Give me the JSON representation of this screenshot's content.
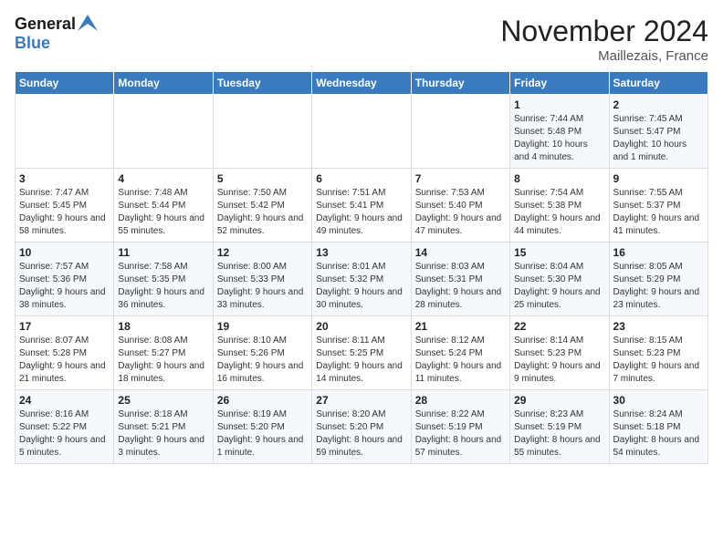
{
  "header": {
    "logo_line1": "General",
    "logo_line2": "Blue",
    "month_title": "November 2024",
    "location": "Maillezais, France"
  },
  "days_of_week": [
    "Sunday",
    "Monday",
    "Tuesday",
    "Wednesday",
    "Thursday",
    "Friday",
    "Saturday"
  ],
  "weeks": [
    [
      {
        "num": "",
        "info": ""
      },
      {
        "num": "",
        "info": ""
      },
      {
        "num": "",
        "info": ""
      },
      {
        "num": "",
        "info": ""
      },
      {
        "num": "",
        "info": ""
      },
      {
        "num": "1",
        "info": "Sunrise: 7:44 AM\nSunset: 5:48 PM\nDaylight: 10 hours and 4 minutes."
      },
      {
        "num": "2",
        "info": "Sunrise: 7:45 AM\nSunset: 5:47 PM\nDaylight: 10 hours and 1 minute."
      }
    ],
    [
      {
        "num": "3",
        "info": "Sunrise: 7:47 AM\nSunset: 5:45 PM\nDaylight: 9 hours and 58 minutes."
      },
      {
        "num": "4",
        "info": "Sunrise: 7:48 AM\nSunset: 5:44 PM\nDaylight: 9 hours and 55 minutes."
      },
      {
        "num": "5",
        "info": "Sunrise: 7:50 AM\nSunset: 5:42 PM\nDaylight: 9 hours and 52 minutes."
      },
      {
        "num": "6",
        "info": "Sunrise: 7:51 AM\nSunset: 5:41 PM\nDaylight: 9 hours and 49 minutes."
      },
      {
        "num": "7",
        "info": "Sunrise: 7:53 AM\nSunset: 5:40 PM\nDaylight: 9 hours and 47 minutes."
      },
      {
        "num": "8",
        "info": "Sunrise: 7:54 AM\nSunset: 5:38 PM\nDaylight: 9 hours and 44 minutes."
      },
      {
        "num": "9",
        "info": "Sunrise: 7:55 AM\nSunset: 5:37 PM\nDaylight: 9 hours and 41 minutes."
      }
    ],
    [
      {
        "num": "10",
        "info": "Sunrise: 7:57 AM\nSunset: 5:36 PM\nDaylight: 9 hours and 38 minutes."
      },
      {
        "num": "11",
        "info": "Sunrise: 7:58 AM\nSunset: 5:35 PM\nDaylight: 9 hours and 36 minutes."
      },
      {
        "num": "12",
        "info": "Sunrise: 8:00 AM\nSunset: 5:33 PM\nDaylight: 9 hours and 33 minutes."
      },
      {
        "num": "13",
        "info": "Sunrise: 8:01 AM\nSunset: 5:32 PM\nDaylight: 9 hours and 30 minutes."
      },
      {
        "num": "14",
        "info": "Sunrise: 8:03 AM\nSunset: 5:31 PM\nDaylight: 9 hours and 28 minutes."
      },
      {
        "num": "15",
        "info": "Sunrise: 8:04 AM\nSunset: 5:30 PM\nDaylight: 9 hours and 25 minutes."
      },
      {
        "num": "16",
        "info": "Sunrise: 8:05 AM\nSunset: 5:29 PM\nDaylight: 9 hours and 23 minutes."
      }
    ],
    [
      {
        "num": "17",
        "info": "Sunrise: 8:07 AM\nSunset: 5:28 PM\nDaylight: 9 hours and 21 minutes."
      },
      {
        "num": "18",
        "info": "Sunrise: 8:08 AM\nSunset: 5:27 PM\nDaylight: 9 hours and 18 minutes."
      },
      {
        "num": "19",
        "info": "Sunrise: 8:10 AM\nSunset: 5:26 PM\nDaylight: 9 hours and 16 minutes."
      },
      {
        "num": "20",
        "info": "Sunrise: 8:11 AM\nSunset: 5:25 PM\nDaylight: 9 hours and 14 minutes."
      },
      {
        "num": "21",
        "info": "Sunrise: 8:12 AM\nSunset: 5:24 PM\nDaylight: 9 hours and 11 minutes."
      },
      {
        "num": "22",
        "info": "Sunrise: 8:14 AM\nSunset: 5:23 PM\nDaylight: 9 hours and 9 minutes."
      },
      {
        "num": "23",
        "info": "Sunrise: 8:15 AM\nSunset: 5:23 PM\nDaylight: 9 hours and 7 minutes."
      }
    ],
    [
      {
        "num": "24",
        "info": "Sunrise: 8:16 AM\nSunset: 5:22 PM\nDaylight: 9 hours and 5 minutes."
      },
      {
        "num": "25",
        "info": "Sunrise: 8:18 AM\nSunset: 5:21 PM\nDaylight: 9 hours and 3 minutes."
      },
      {
        "num": "26",
        "info": "Sunrise: 8:19 AM\nSunset: 5:20 PM\nDaylight: 9 hours and 1 minute."
      },
      {
        "num": "27",
        "info": "Sunrise: 8:20 AM\nSunset: 5:20 PM\nDaylight: 8 hours and 59 minutes."
      },
      {
        "num": "28",
        "info": "Sunrise: 8:22 AM\nSunset: 5:19 PM\nDaylight: 8 hours and 57 minutes."
      },
      {
        "num": "29",
        "info": "Sunrise: 8:23 AM\nSunset: 5:19 PM\nDaylight: 8 hours and 55 minutes."
      },
      {
        "num": "30",
        "info": "Sunrise: 8:24 AM\nSunset: 5:18 PM\nDaylight: 8 hours and 54 minutes."
      }
    ]
  ]
}
